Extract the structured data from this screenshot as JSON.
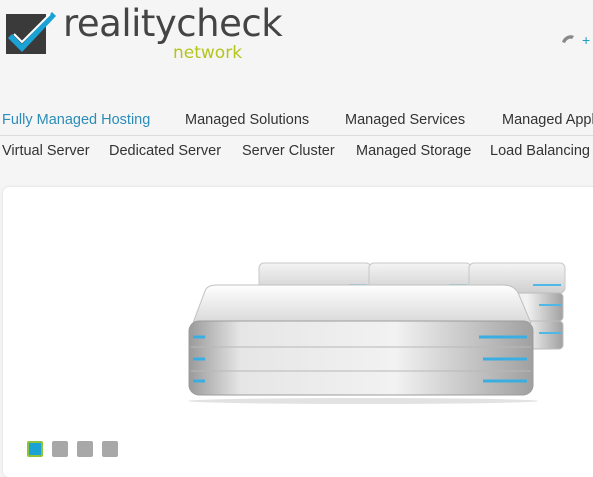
{
  "logo": {
    "name": "realitycheck",
    "sub": "network",
    "icon": "checkmark-logo-icon"
  },
  "header": {
    "phone_icon": "phone-icon",
    "phone_text": "+"
  },
  "nav_main": [
    {
      "label": "Fully Managed Hosting",
      "active": true
    },
    {
      "label": "Managed Solutions",
      "active": false
    },
    {
      "label": "Managed Services",
      "active": false
    },
    {
      "label": "Managed Appl",
      "active": false
    }
  ],
  "nav_sub": [
    {
      "label": "Virtual Server"
    },
    {
      "label": "Dedicated Server"
    },
    {
      "label": "Server Cluster"
    },
    {
      "label": "Managed Storage"
    },
    {
      "label": "Load Balancing"
    }
  ],
  "slider": {
    "image": "server-stack-illustration",
    "dots": [
      {
        "active": true
      },
      {
        "active": false
      },
      {
        "active": false
      },
      {
        "active": false
      }
    ]
  },
  "colors": {
    "accent": "#2b8db8",
    "brand_green": "#b5c41f",
    "logo_blue": "#1aa2d4"
  }
}
